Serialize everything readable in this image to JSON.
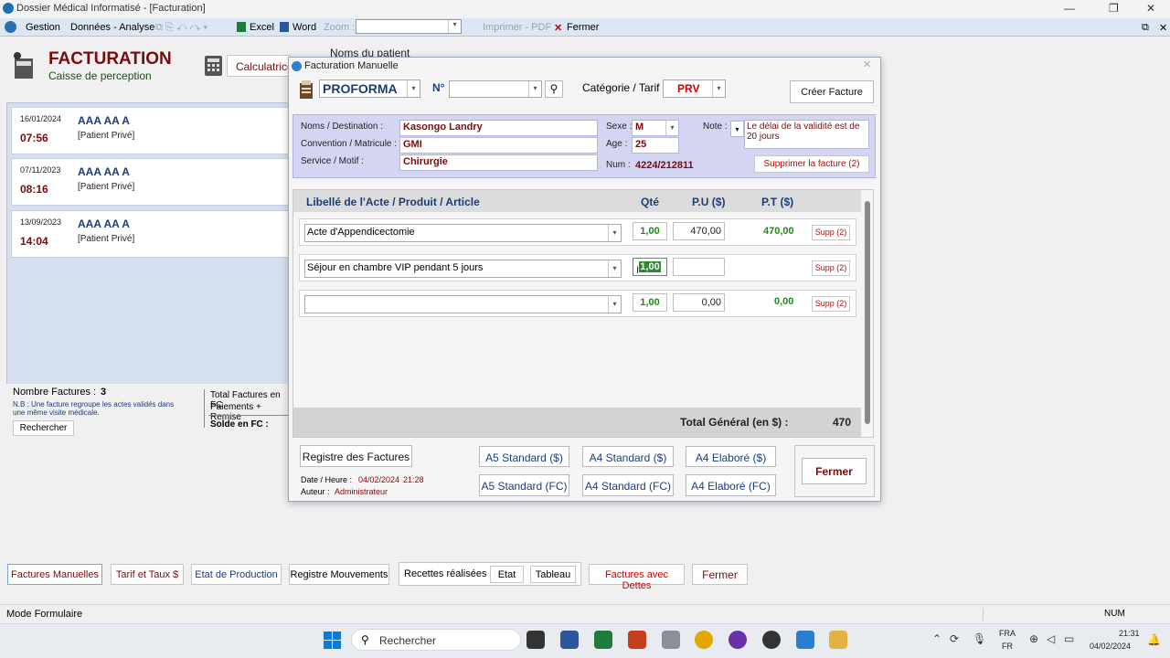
{
  "window": {
    "title": "Dossier Médical Informatisé - [Facturation]"
  },
  "menu": {
    "gestion": "Gestion",
    "donnees": "Données - Analyse",
    "excel": "Excel",
    "word": "Word",
    "zoom": "Zoom :",
    "imprimer": "Imprimer - PDF",
    "fermer": "Fermer"
  },
  "header": {
    "title": "FACTURATION",
    "subtitle": "Caisse de perception",
    "calc": "Calculatrice",
    "noms_patient": "Noms du patient"
  },
  "patients": [
    {
      "date": "16/01/2024",
      "time": "07:56",
      "name": "AAA AA A",
      "type": "[Patient Privé]"
    },
    {
      "date": "07/11/2023",
      "time": "08:16",
      "name": "AAA AA A",
      "type": "[Patient Privé]"
    },
    {
      "date": "13/09/2023",
      "time": "14:04",
      "name": "AAA AA A",
      "type": "[Patient Privé]"
    }
  ],
  "summary": {
    "nb_label": "Nombre Factures :",
    "nb_value": "3",
    "note": "N.B : Une facture regroupe les actes validés dans une même visite médicale.",
    "search": "Rechercher",
    "total_fc": "Total Factures en FC",
    "paiements": "Paiements + Remise",
    "solde": "Solde en FC :"
  },
  "dialog": {
    "title": "Facturation Manuelle",
    "doc_type": "PROFORMA",
    "num_label": "N°",
    "cat_label": "Catégorie / Tarif :",
    "cat_value": "PRV",
    "create": "Créer Facture",
    "fields": {
      "nom_label": "Noms / Destination :",
      "nom": "Kasongo Landry",
      "conv_label": "Convention / Matricule :",
      "conv": "GMI",
      "serv_label": "Service / Motif :",
      "serv": "Chirurgie",
      "sexe_label": "Sexe :",
      "sexe": "M",
      "age_label": "Age :",
      "age": "25",
      "num_label": "Num :",
      "num": "4224/212811",
      "note_label": "Note :",
      "note": "Le délai de la validité est de 20 jours",
      "delete": "Supprimer la facture (2)"
    },
    "columns": {
      "libelle": "Libellé de l'Acte / Produit / Article",
      "qte": "Qté",
      "pu": "P.U ($)",
      "pt": "P.T ($)"
    },
    "lines": [
      {
        "libelle": "Acte d'Appendicectomie",
        "qte": "1,00",
        "pu": "470,00",
        "pt": "470,00",
        "supp": "Supp (2)"
      },
      {
        "libelle": "Séjour en chambre VIP pendant 5 jours",
        "qte": "1,00",
        "pu": "",
        "pt": "",
        "supp": "Supp (2)"
      },
      {
        "libelle": "",
        "qte": "1,00",
        "pu": "0,00",
        "pt": "0,00",
        "supp": "Supp (2)"
      }
    ],
    "total_label": "Total Général (en $) :",
    "total_value": "470",
    "registre": "Registre des Factures",
    "date_label": "Date / Heure :",
    "date_value": "04/02/2024",
    "time_value": "21:28",
    "auteur_label": "Auteur :",
    "auteur_value": "Administrateur",
    "print_buttons": [
      "A5 Standard ($)",
      "A4 Standard ($)",
      "A4 Elaboré ($)",
      "A5 Standard (FC)",
      "A4 Standard (FC)",
      "A4 Elaboré (FC)"
    ],
    "close": "Fermer"
  },
  "bottom_buttons": {
    "factures": "Factures Manuelles",
    "tarif": "Tarif et Taux $",
    "production": "Etat de Production",
    "registre": "Registre Mouvements",
    "recettes": "Recettes réalisées :",
    "etat": "Etat",
    "tableau": "Tableau",
    "dettes": "Factures avec Dettes",
    "fermer": "Fermer"
  },
  "status": {
    "mode": "Mode Formulaire",
    "num": "NUM"
  },
  "taskbar": {
    "search": "Rechercher",
    "lang1": "FRA",
    "lang2": "FR",
    "time": "21:31",
    "date": "04/02/2024"
  }
}
